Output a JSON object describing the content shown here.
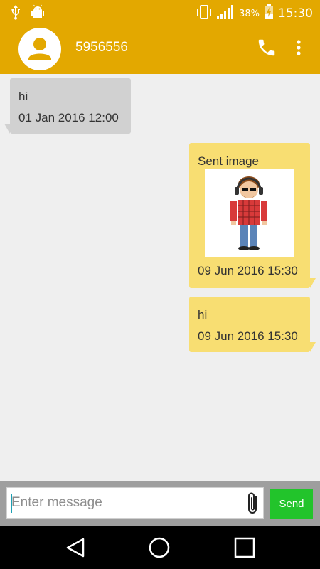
{
  "status_bar": {
    "battery_percent": "38%",
    "time": "15:30",
    "icons": [
      "usb-icon",
      "android-debug-icon",
      "vibrate-icon",
      "signal-icon",
      "battery-charging-icon"
    ]
  },
  "header": {
    "contact_name": "5956556",
    "icons": [
      "avatar-icon",
      "phone-icon",
      "more-vert-icon"
    ]
  },
  "messages": [
    {
      "direction": "incoming",
      "text": "hi",
      "time": "01 Jan 2016 12:00"
    },
    {
      "direction": "outgoing",
      "text": "Sent image",
      "time": "09 Jun 2016 15:30",
      "has_image": true
    },
    {
      "direction": "outgoing",
      "text": "hi",
      "time": "09 Jun 2016 15:30"
    }
  ],
  "composer": {
    "placeholder": "Enter message",
    "value": "",
    "send_label": "Send",
    "icons": [
      "paperclip-icon"
    ]
  },
  "nav_bar": {
    "icons": [
      "back-icon",
      "home-icon",
      "recents-icon"
    ]
  },
  "colors": {
    "accent": "#e3a800",
    "incoming_bubble": "#d1d1d1",
    "outgoing_bubble": "#f8de72",
    "send_button": "#22c42b"
  }
}
